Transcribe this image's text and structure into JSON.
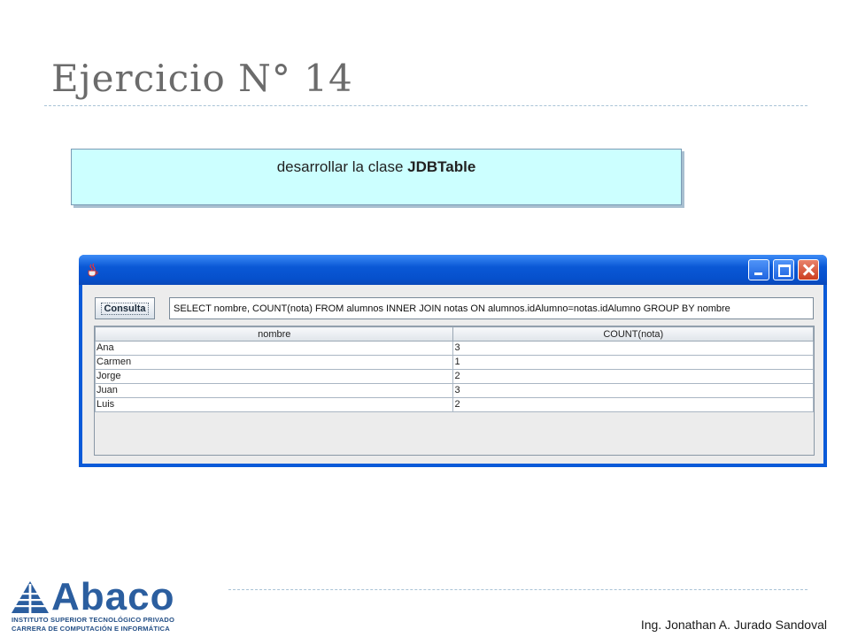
{
  "slide": {
    "title": "Ejercicio N° 14",
    "task_prefix": "desarrollar la clase ",
    "task_bold": "JDBTable",
    "author": "Ing. Jonathan A. Jurado Sandoval"
  },
  "logo": {
    "wordmark": "Abaco",
    "line1": "INSTITUTO SUPERIOR TECNOLÓGICO PRIVADO",
    "line2": "CARRERA DE COMPUTACIÓN E INFORMÁTICA",
    "icon": "abaco-pyramid-icon"
  },
  "window": {
    "app_icon": "java-cup-icon",
    "controls": [
      "minimize-icon",
      "maximize-icon",
      "close-icon"
    ],
    "consulta_label": "Consulta",
    "sql_query": "SELECT nombre, COUNT(nota) FROM alumnos INNER JOIN notas ON alumnos.idAlumno=notas.idAlumno GROUP BY nombre",
    "columns": [
      "nombre",
      "COUNT(nota)"
    ],
    "rows": [
      [
        "Ana",
        "3"
      ],
      [
        "Carmen",
        "1"
      ],
      [
        "Jorge",
        "2"
      ],
      [
        "Juan",
        "3"
      ],
      [
        "Luis",
        "2"
      ]
    ]
  },
  "colors": {
    "title_gray": "#6b6b6b",
    "task_box_bg": "#ccffff",
    "xp_blue": "#0a5ad8",
    "logo_blue": "#2b5e9f"
  }
}
